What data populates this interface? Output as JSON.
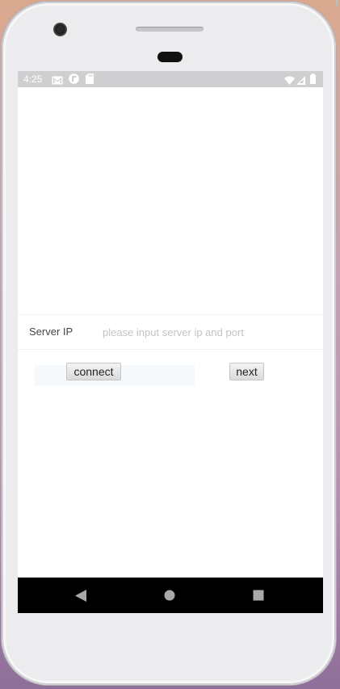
{
  "status_bar": {
    "time": "4:25",
    "left_icons": [
      "gmail-icon",
      "notification-app-icon",
      "sd-card-icon"
    ],
    "right_icons": [
      "wifi-icon",
      "signal-icon",
      "battery-icon"
    ]
  },
  "form": {
    "server_ip_label": "Server IP",
    "server_ip_value": "",
    "server_ip_placeholder": "please input server ip and port"
  },
  "buttons": {
    "connect_label": "connect",
    "next_label": "next"
  },
  "nav_bar": {
    "buttons": [
      "back-icon",
      "home-icon",
      "recents-icon"
    ]
  },
  "colors": {
    "status_bar_bg": "#cfcfd1",
    "screen_bg": "#ffffff",
    "nav_bar_bg": "#000000"
  }
}
